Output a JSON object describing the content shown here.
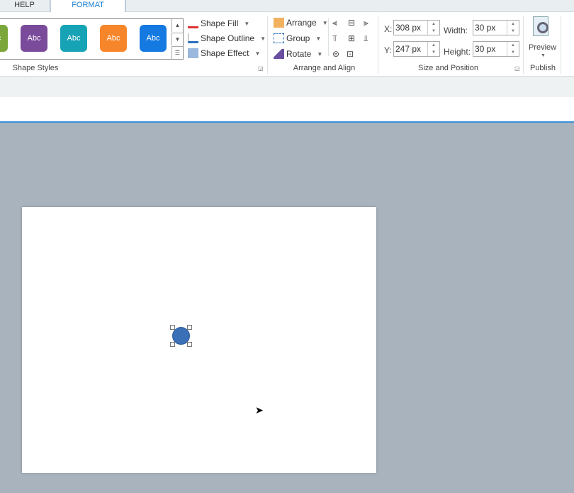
{
  "tabs": [
    {
      "label": "HELP"
    },
    {
      "label": "FORMAT"
    }
  ],
  "shape_styles": {
    "swatches": [
      {
        "label": "Abc",
        "color": "#7ba63a"
      },
      {
        "label": "Abc",
        "color": "#7a4b9a"
      },
      {
        "label": "Abc",
        "color": "#16a3b5"
      },
      {
        "label": "Abc",
        "color": "#f7862a"
      },
      {
        "label": "Abc",
        "color": "#1479e0"
      }
    ],
    "fill": "Shape Fill",
    "outline": "Shape Outline",
    "effect": "Shape Effect",
    "group_label": "Shape Styles"
  },
  "arrange": {
    "arrange": "Arrange",
    "group": "Group",
    "rotate": "Rotate",
    "group_label": "Arrange and Align"
  },
  "size": {
    "x_label": "X:",
    "x": "308 px",
    "y_label": "Y:",
    "y": "247 px",
    "width_label": "Width:",
    "width": "30 px",
    "height_label": "Height:",
    "height": "30 px",
    "group_label": "Size and Position"
  },
  "publish": {
    "preview": "Preview",
    "group_label": "Publish"
  },
  "colors": {
    "accent": "#1a7fd0",
    "shape": "#3b6fb6"
  }
}
